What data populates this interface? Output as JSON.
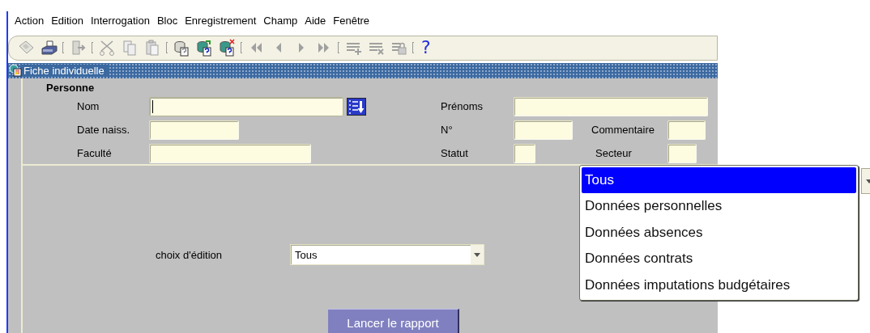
{
  "menu_bar": [
    {
      "label": "Action"
    },
    {
      "label": "Edition"
    },
    {
      "label": "Interrogation"
    },
    {
      "label": "Bloc"
    },
    {
      "label": "Enregistrement"
    },
    {
      "label": "Champ"
    },
    {
      "label": "Aide"
    },
    {
      "label": "Fenêtre"
    }
  ],
  "toolbar": [
    {
      "kind": "save",
      "disabled": true
    },
    {
      "kind": "print",
      "disabled": false
    },
    {
      "kind": "separator"
    },
    {
      "kind": "exit",
      "disabled": true
    },
    {
      "kind": "separator"
    },
    {
      "kind": "cut",
      "disabled": true
    },
    {
      "kind": "copy",
      "disabled": true
    },
    {
      "kind": "paste",
      "disabled": true
    },
    {
      "kind": "separator"
    },
    {
      "kind": "query",
      "disabled": true
    },
    {
      "kind": "execute",
      "disabled": false
    },
    {
      "kind": "cancel",
      "disabled": false
    },
    {
      "kind": "separator"
    },
    {
      "kind": "first",
      "disabled": true
    },
    {
      "kind": "previous",
      "disabled": true
    },
    {
      "kind": "next",
      "disabled": true
    },
    {
      "kind": "last",
      "disabled": true
    },
    {
      "kind": "separator"
    },
    {
      "kind": "insert",
      "disabled": true
    },
    {
      "kind": "delete",
      "disabled": true
    },
    {
      "kind": "lock",
      "disabled": true
    },
    {
      "kind": "separator"
    },
    {
      "kind": "help",
      "disabled": false,
      "label": "?"
    }
  ],
  "window": {
    "title": "Fiche individuelle"
  },
  "person": {
    "title": "Personne",
    "fields": [
      {
        "label": "Nom",
        "focused": true,
        "list_button": true
      },
      {
        "label": "Prénoms",
        "focused": false
      },
      {
        "label": "Date naiss.",
        "focused": false
      },
      {
        "label": "N°",
        "focused": false
      },
      {
        "label": "Commentaire",
        "focused": false
      },
      {
        "label": "Faculté",
        "focused": false
      },
      {
        "label": "Statut",
        "focused": false
      },
      {
        "label": "Secteur",
        "focused": false
      }
    ]
  },
  "edition": {
    "label": "choix d'édition",
    "value": "Tous",
    "options": [
      {
        "label": "Tous",
        "selected": true
      },
      {
        "label": "Données personnelles",
        "selected": false
      },
      {
        "label": "Données absences",
        "selected": false
      },
      {
        "label": "Données contrats",
        "selected": false
      },
      {
        "label": "Données imputations budgétaires",
        "selected": false
      }
    ]
  },
  "run_button": {
    "label": "Lancer le rapport"
  }
}
